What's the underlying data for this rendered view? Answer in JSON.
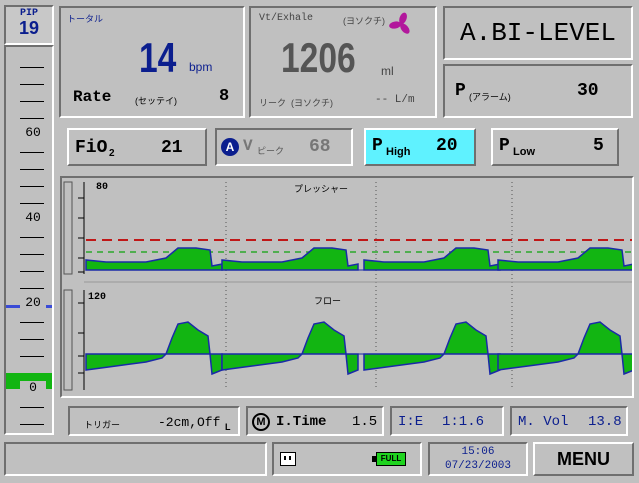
{
  "pip": {
    "label": "PIP",
    "value": "19"
  },
  "gauge": {
    "labels": [
      "60",
      "40",
      "20",
      "0"
    ],
    "pip_level": 19,
    "fill_level": 0
  },
  "rate": {
    "title": "トータル",
    "value": "14",
    "unit": "bpm",
    "set_label": "Rate",
    "set_sub": "(セッテイ)",
    "set_value": "8"
  },
  "volume": {
    "title": "Vt/Exhale",
    "title_sub": "(ヨソクチ)",
    "value": "1206",
    "unit": "ml",
    "leak_label": "リーク",
    "leak_sub": "(ヨソクチ)",
    "leak_value": "-- L/m"
  },
  "mode": {
    "label": "A.BI-LEVEL"
  },
  "p_alarm": {
    "label": "P",
    "sub": "(アラーム)",
    "value": "30"
  },
  "fio2": {
    "label": "FiO",
    "sub": "2",
    "value": "21"
  },
  "vpeak": {
    "badge": "A",
    "label": "V",
    "sub": "ピーク",
    "value": "68"
  },
  "phigh": {
    "label": "P",
    "sub": "High",
    "value": "20"
  },
  "plow": {
    "label": "P",
    "sub": "Low",
    "value": "5"
  },
  "waveforms": {
    "pressure": {
      "title": "プレッシャー",
      "max": "80"
    },
    "flow": {
      "title": "フロー",
      "max": "120"
    }
  },
  "trigger": {
    "label": "トリガー",
    "value": "-2cm,Off",
    "value_sub": "L"
  },
  "itime": {
    "badge": "M",
    "label": "I.Time",
    "value": "1.5"
  },
  "ie": {
    "label": "I:E",
    "value": "1:1.6"
  },
  "mvol": {
    "label": "M. Vol",
    "value": "13.8"
  },
  "status": {
    "battery": "FULL",
    "time": "15:06",
    "date": "07/23/2003"
  },
  "menu": {
    "label": "MENU"
  },
  "colors": {
    "accent_blue": "#0b1e8e",
    "fan": "#b2189c",
    "phigh_bg": "#5ff2ff",
    "wave_green": "#12b512",
    "wave_line": "#1a2aa8",
    "alarm_red": "#c01818",
    "threshold_green": "#2aa82a"
  }
}
